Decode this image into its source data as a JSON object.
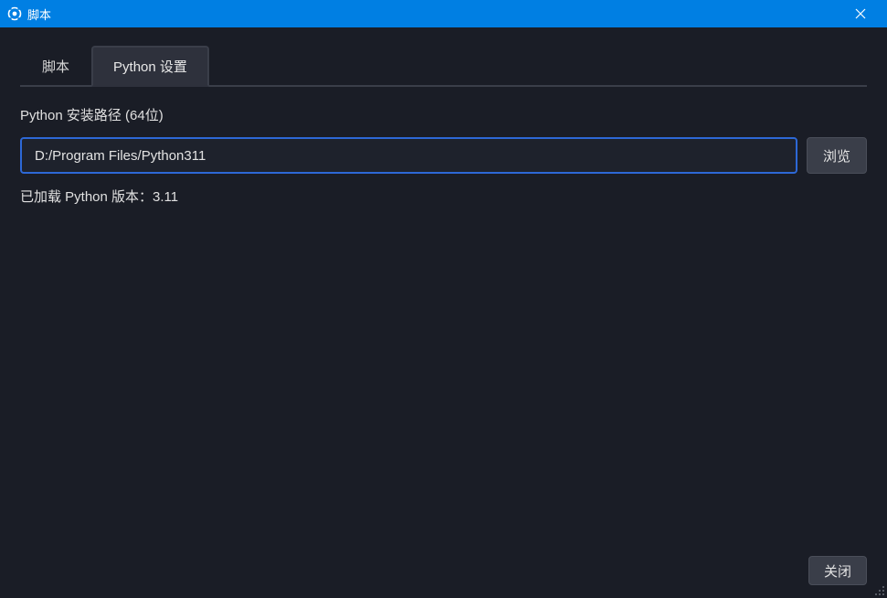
{
  "window": {
    "title": "脚本"
  },
  "tabs": {
    "scripts": "脚本",
    "python_settings": "Python 设置"
  },
  "panel": {
    "path_label": "Python 安装路径 (64位)",
    "path_value": "D:/Program Files/Python311",
    "browse_label": "浏览",
    "status_text": "已加载 Python 版本：3.11"
  },
  "footer": {
    "close_label": "关闭"
  }
}
